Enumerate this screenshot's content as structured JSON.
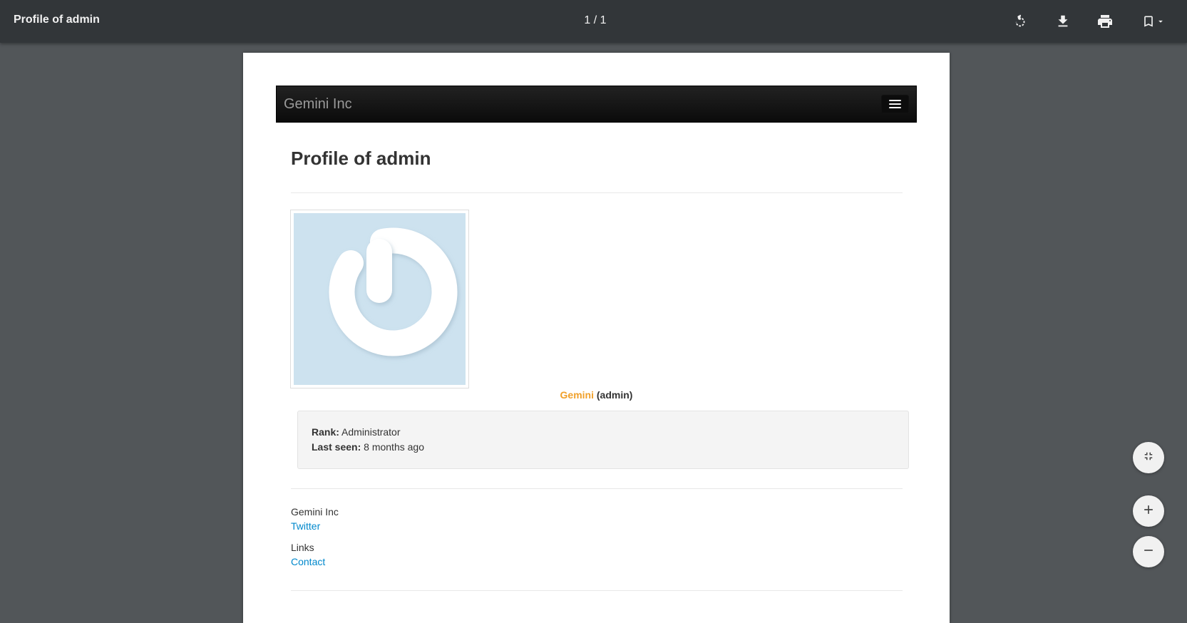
{
  "toolbar": {
    "title": "Profile of admin",
    "page_current": "1",
    "page_total": "1",
    "page_indicator": "1 / 1",
    "icons": [
      "rotate-icon",
      "download-icon",
      "print-icon",
      "bookmark-icon",
      "chevron-down-icon"
    ]
  },
  "document": {
    "navbar": {
      "brand": "Gemini Inc",
      "menu_icon": "hamburger-icon"
    },
    "heading": "Profile of admin",
    "avatar_icon": "power-icon",
    "user": {
      "display_name": "Gemini",
      "login": "(admin)"
    },
    "info": {
      "rank_label": "Rank:",
      "rank_value": "Administrator",
      "last_seen_label": "Last seen:",
      "last_seen_value": "8 months ago"
    },
    "footer": {
      "company": "Gemini Inc",
      "twitter_link": "Twitter",
      "links_heading": "Links",
      "contact_link": "Contact"
    }
  },
  "zoom_controls": {
    "icons": [
      "fit-page-icon",
      "zoom-in-icon",
      "zoom-out-icon"
    ]
  },
  "colors": {
    "toolbar_bg": "#323639",
    "viewer_bg": "#525659",
    "accent_name": "#f0a02a",
    "link": "#0088cc",
    "avatar_bg": "#cde2ef"
  }
}
